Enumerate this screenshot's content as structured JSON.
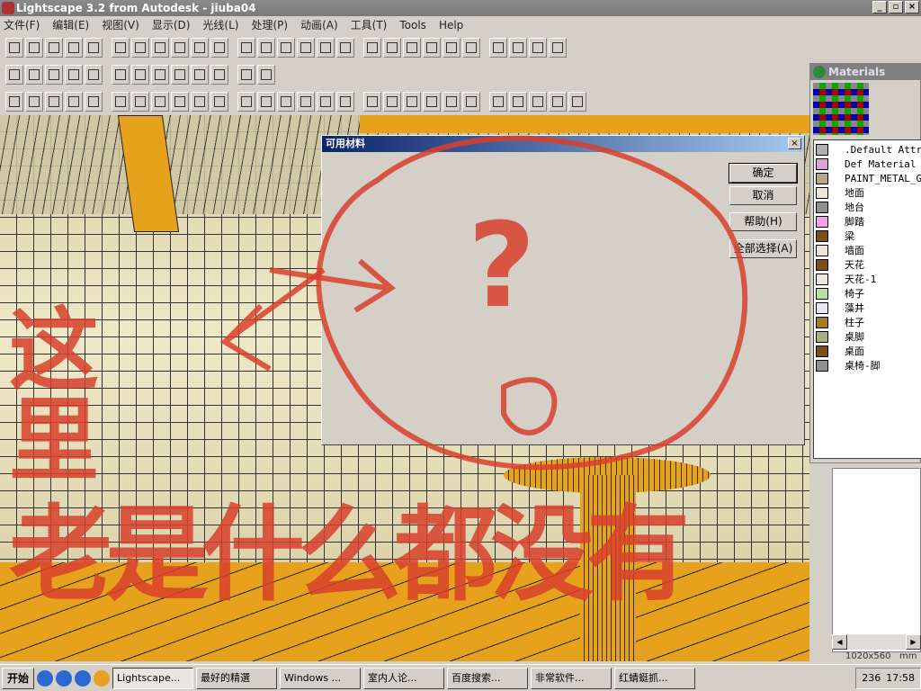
{
  "window": {
    "title": "Lightscape 3.2 from Autodesk - jiuba04",
    "min": "_",
    "max": "▫",
    "close": "×"
  },
  "menu": [
    "文件(F)",
    "编辑(E)",
    "视图(V)",
    "显示(D)",
    "光线(L)",
    "处理(P)",
    "动画(A)",
    "工具(T)",
    "Tools",
    "Help"
  ],
  "dialog": {
    "title": "可用材料",
    "close": "×",
    "buttons": [
      "确定",
      "取消",
      "帮助(H)",
      "全部选择(A)"
    ]
  },
  "materials": {
    "title": "Materials",
    "items": [
      {
        "name": ".Default Attr",
        "color": "#b0b0b0"
      },
      {
        "name": "Def Material",
        "color": "#e0a0d8"
      },
      {
        "name": "PAINT_METAL_GR",
        "color": "#b8a888"
      },
      {
        "name": "地面",
        "color": "#ebe6d8"
      },
      {
        "name": "地台",
        "color": "#909090"
      },
      {
        "name": "脚踏",
        "color": "#f8a0f0"
      },
      {
        "name": "梁",
        "color": "#7a5218"
      },
      {
        "name": "墙面",
        "color": "#ebe6d8"
      },
      {
        "name": "天花",
        "color": "#7a5218"
      },
      {
        "name": "天花-1",
        "color": "#ebe6e0"
      },
      {
        "name": "椅子",
        "color": "#b8e0a0"
      },
      {
        "name": "藻井",
        "color": "#e8e8f0"
      },
      {
        "name": "柱子",
        "color": "#a87a20"
      },
      {
        "name": "桌脚",
        "color": "#a8b080"
      },
      {
        "name": "桌面",
        "color": "#7a5218"
      },
      {
        "name": "桌椅-脚",
        "color": "#909090"
      }
    ]
  },
  "status": {
    "resolution": "1020x560",
    "units": "mm"
  },
  "annotation": {
    "line1": "这里",
    "line2": "老是什么都没有",
    "mark": "?"
  },
  "taskbar": {
    "start": "开始",
    "tasks": [
      "Lightscape...",
      "最好的精選",
      "Windows ...",
      "室内人论...",
      "百度搜索...",
      "非常软件...",
      "红蜻蜓抓..."
    ],
    "tray_num": "236",
    "clock": "17:58"
  }
}
